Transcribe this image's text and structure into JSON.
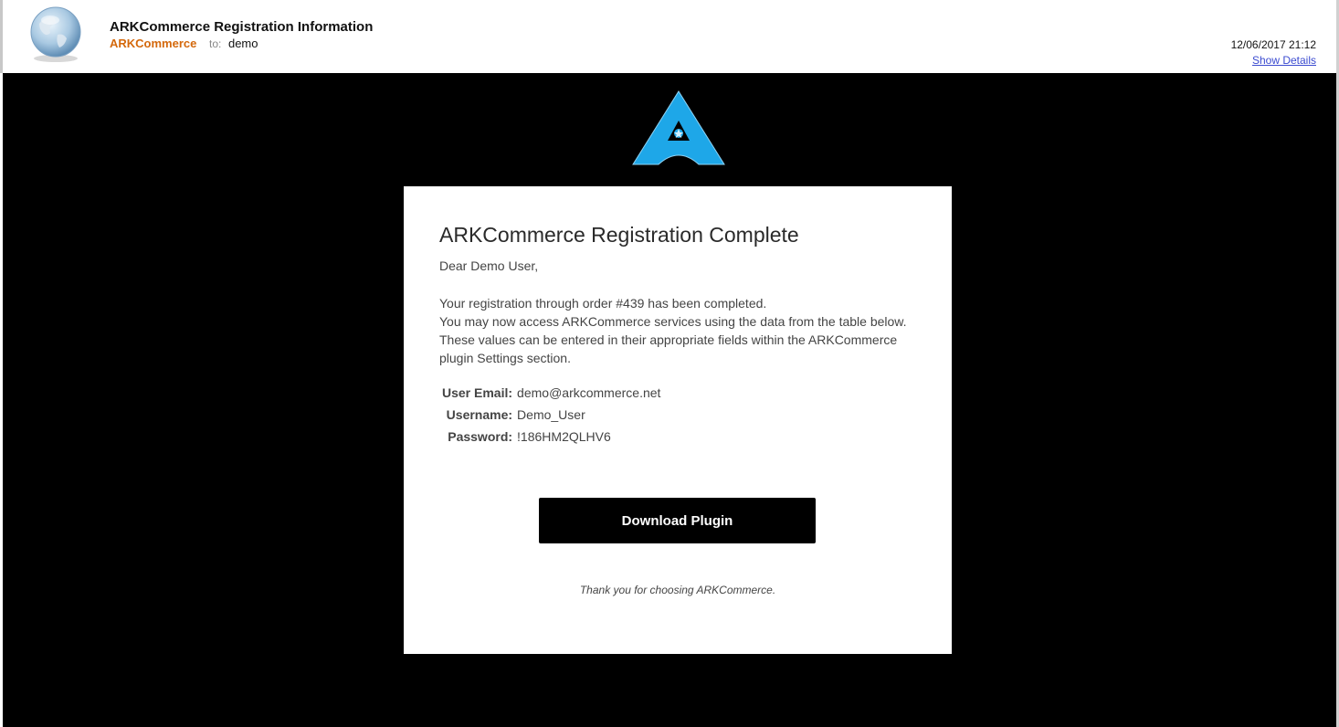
{
  "header": {
    "subject": "ARKCommerce Registration Information",
    "sender": "ARKCommerce",
    "to_label": "to:",
    "recipient": "demo",
    "date": "12/06/2017 21:12",
    "show_details": "Show Details",
    "avatar_icon": "globe-icon"
  },
  "email": {
    "logo_icon": "ark-logo-icon",
    "title": "ARKCommerce Registration Complete",
    "greeting": "Dear Demo User,",
    "intro_line1": "Your registration through order #439 has been completed.",
    "intro_line2": "You may now access ARKCommerce services using the data from the table below. These values can be entered in their appropriate fields within the ARKCommerce plugin Settings section.",
    "credentials": [
      {
        "label": "User Email:",
        "value": "demo@arkcommerce.net"
      },
      {
        "label": "Username:",
        "value": "Demo_User"
      },
      {
        "label": "Password:",
        "value": "!186HM2QLHV6"
      }
    ],
    "download_label": "Download Plugin",
    "thanks": "Thank you for choosing ARKCommerce."
  },
  "colors": {
    "sender": "#d4680b",
    "link": "#3b4bd0",
    "logo_blue": "#1ea7e8",
    "email_bg": "#000000"
  }
}
